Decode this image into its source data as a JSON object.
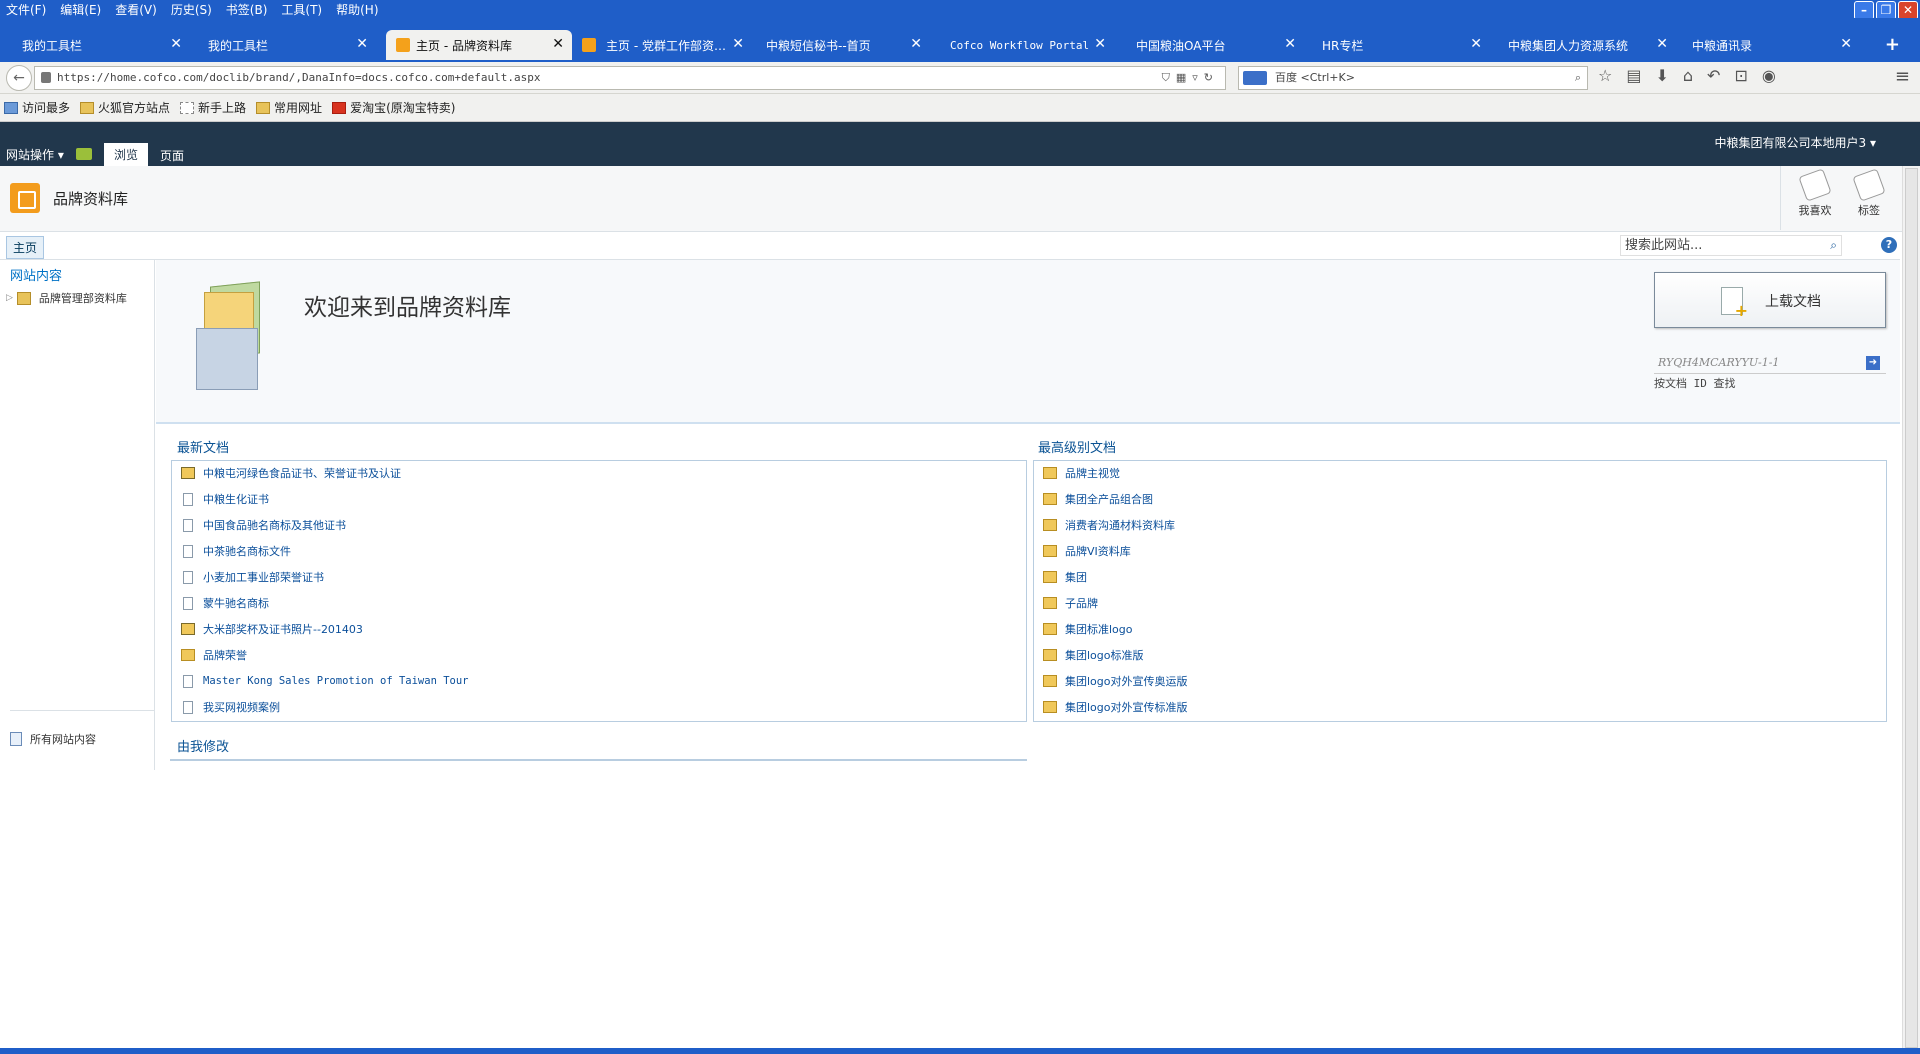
{
  "browser": {
    "menu": [
      "文件(F)",
      "编辑(E)",
      "查看(V)",
      "历史(S)",
      "书签(B)",
      "工具(T)",
      "帮助(H)"
    ],
    "tabs": [
      {
        "label": "我的工具栏"
      },
      {
        "label": "我的工具栏"
      },
      {
        "label": "主页 - 品牌资料库"
      },
      {
        "label": "主页 - 党群工作部资…"
      },
      {
        "label": "中粮短信秘书--首页"
      },
      {
        "label": "Cofco Workflow Portal"
      },
      {
        "label": "中国粮油OA平台"
      },
      {
        "label": "HR专栏"
      },
      {
        "label": "中粮集团人力资源系统"
      },
      {
        "label": "中粮通讯录"
      }
    ],
    "url": "https://home.cofco.com/doclib/brand/,DanaInfo=docs.cofco.com+default.aspx",
    "search_engine": "百度",
    "search_placeholder": "百度 <Ctrl+K>",
    "bookmarks": [
      "访问最多",
      "火狐官方站点",
      "新手上路",
      "常用网址",
      "爱淘宝(原淘宝特卖)"
    ]
  },
  "sharepoint": {
    "site_actions": "网站操作",
    "ribbon_tabs": {
      "browse": "浏览",
      "page": "页面"
    },
    "user": "中粮集团有限公司本地用户3",
    "site_title": "品牌资料库",
    "ribbon_buttons": {
      "like": "我喜欢",
      "tags": "标签"
    },
    "topnav_home": "主页",
    "search_placeholder": "搜索此网站...",
    "help": "?"
  },
  "leftnav": {
    "header": "网站内容",
    "item": "品牌管理部资料库",
    "all_content": "所有网站内容"
  },
  "welcome": {
    "title": "欢迎来到品牌资料库",
    "upload_label": "上载文档",
    "docid_value": "RYQH4MCARYYU-1-1",
    "docid_label": "按文档 ID 查找"
  },
  "recent_docs": {
    "title": "最新文档",
    "items": [
      {
        "label": "中粮屯河绿色食品证书、荣誉证书及认证",
        "icon": "folder-doc"
      },
      {
        "label": "中粮生化证书",
        "icon": "doc"
      },
      {
        "label": "中国食品驰名商标及其他证书",
        "icon": "doc"
      },
      {
        "label": "中茶驰名商标文件",
        "icon": "doc"
      },
      {
        "label": "小麦加工事业部荣誉证书",
        "icon": "doc"
      },
      {
        "label": "蒙牛驰名商标",
        "icon": "doc"
      },
      {
        "label": "大米部奖杯及证书照片--201403",
        "icon": "folder-doc"
      },
      {
        "label": "品牌荣誉",
        "icon": "folder"
      },
      {
        "label": "Master Kong Sales Promotion of Taiwan Tour",
        "icon": "doc"
      },
      {
        "label": "我买网视频案例",
        "icon": "doc"
      }
    ]
  },
  "top_docs": {
    "title": "最高级别文档",
    "items": [
      {
        "label": "品牌主视觉",
        "icon": "folder"
      },
      {
        "label": "集团全产品组合图",
        "icon": "folder"
      },
      {
        "label": "消费者沟通材料资料库",
        "icon": "folder"
      },
      {
        "label": "品牌VI资料库",
        "icon": "folder"
      },
      {
        "label": "集团",
        "icon": "folder"
      },
      {
        "label": "子品牌",
        "icon": "folder"
      },
      {
        "label": "集团标准logo",
        "icon": "folder"
      },
      {
        "label": "集团logo标准版",
        "icon": "folder"
      },
      {
        "label": "集团logo对外宣传奥运版",
        "icon": "folder"
      },
      {
        "label": "集团logo对外宣传标准版",
        "icon": "folder"
      }
    ]
  },
  "my_edits": {
    "title": "由我修改"
  }
}
